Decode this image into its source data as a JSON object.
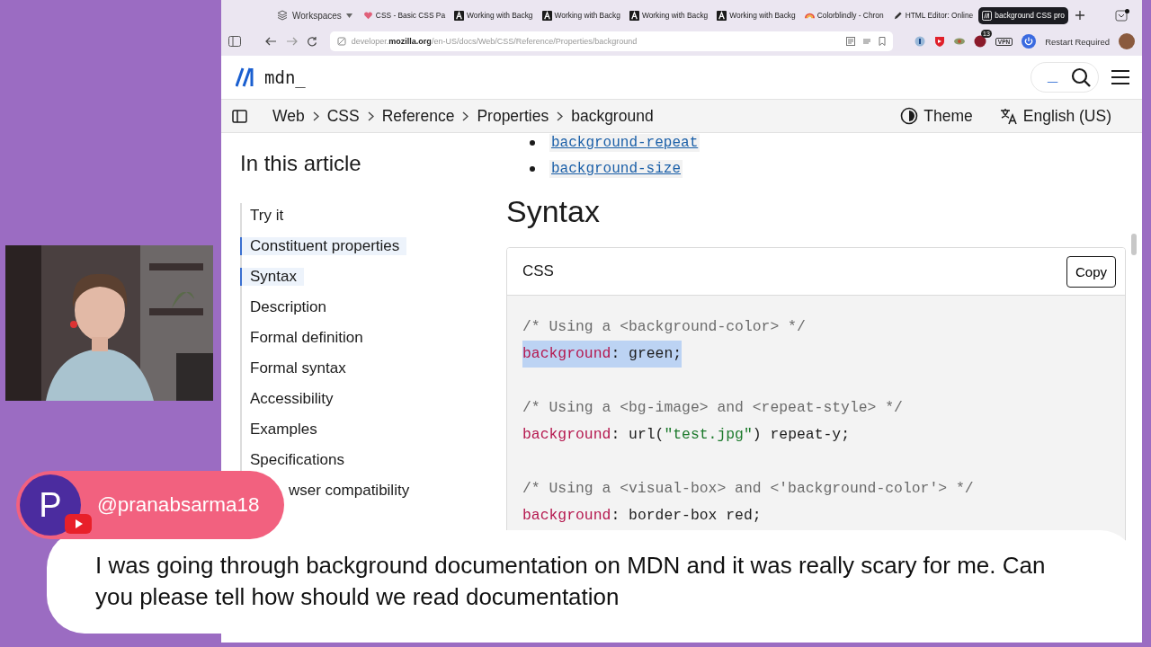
{
  "browser": {
    "workspaces": "Workspaces",
    "tabs": [
      {
        "title": "CSS - Basic CSS Pa",
        "selected": false
      },
      {
        "title": "Working with Backg",
        "selected": false
      },
      {
        "title": "Working with Backg",
        "selected": false
      },
      {
        "title": "Working with Backg",
        "selected": false
      },
      {
        "title": "Working with Backg",
        "selected": false
      },
      {
        "title": "Colorblindly - Chron",
        "selected": false
      },
      {
        "title": "HTML Editor: Online",
        "selected": false
      },
      {
        "title": "background CSS pro",
        "selected": true
      }
    ],
    "url": "developer.**mozilla.org**/en-US/docs/Web/CSS/Reference/Properties/background",
    "extension_badge": "13",
    "vpn": "VPN",
    "restart": "Restart Required"
  },
  "mdn": {
    "logo": "mdn_",
    "search_text": "_",
    "breadcrumbs": [
      "Web",
      "CSS",
      "Reference",
      "Properties",
      "background"
    ],
    "theme": "Theme",
    "language": "English (US)"
  },
  "toc": {
    "title": "In this article",
    "items": [
      {
        "label": "Try it",
        "selected": false
      },
      {
        "label": "Constituent properties",
        "selected": true
      },
      {
        "label": "Syntax",
        "selected": true
      },
      {
        "label": "Description",
        "selected": false
      },
      {
        "label": "Formal definition",
        "selected": false
      },
      {
        "label": "Formal syntax",
        "selected": false
      },
      {
        "label": "Accessibility",
        "selected": false
      },
      {
        "label": "Examples",
        "selected": false
      },
      {
        "label": "Specifications",
        "selected": false
      },
      {
        "label": "wser compatibility",
        "selected": false,
        "covered": true
      }
    ]
  },
  "article": {
    "links": [
      "background-repeat",
      "background-size"
    ],
    "heading": "Syntax",
    "code": {
      "language": "CSS",
      "copy": "Copy",
      "groups": [
        [
          {
            "selected": false,
            "tokens": [
              {
                "kind": "comment",
                "text": "/* Using a <background-color> */"
              }
            ]
          },
          {
            "selected": true,
            "tokens": [
              {
                "kind": "property",
                "text": "background"
              },
              {
                "kind": "punct",
                "text": ": "
              },
              {
                "kind": "value",
                "text": "green;"
              }
            ]
          }
        ],
        [
          {
            "selected": false,
            "tokens": [
              {
                "kind": "comment",
                "text": "/* Using a <bg-image> and <repeat-style> */"
              }
            ]
          },
          {
            "selected": false,
            "tokens": [
              {
                "kind": "property",
                "text": "background"
              },
              {
                "kind": "punct",
                "text": ": "
              },
              {
                "kind": "value",
                "text": "url("
              },
              {
                "kind": "string",
                "text": "\"test.jpg\""
              },
              {
                "kind": "value",
                "text": ") repeat-y;"
              }
            ]
          }
        ],
        [
          {
            "selected": false,
            "tokens": [
              {
                "kind": "comment",
                "text": "/* Using a <visual-box> and <'background-color'> */"
              }
            ]
          },
          {
            "selected": false,
            "tokens": [
              {
                "kind": "property",
                "text": "background"
              },
              {
                "kind": "punct",
                "text": ": "
              },
              {
                "kind": "value",
                "text": "border-box red;"
              }
            ]
          }
        ]
      ]
    }
  },
  "comment": {
    "avatar": "P",
    "author": "@pranabsarma18",
    "text": "I was going through background documentation on MDN and it was really scary for me. Can you please tell how should we read documentation"
  }
}
